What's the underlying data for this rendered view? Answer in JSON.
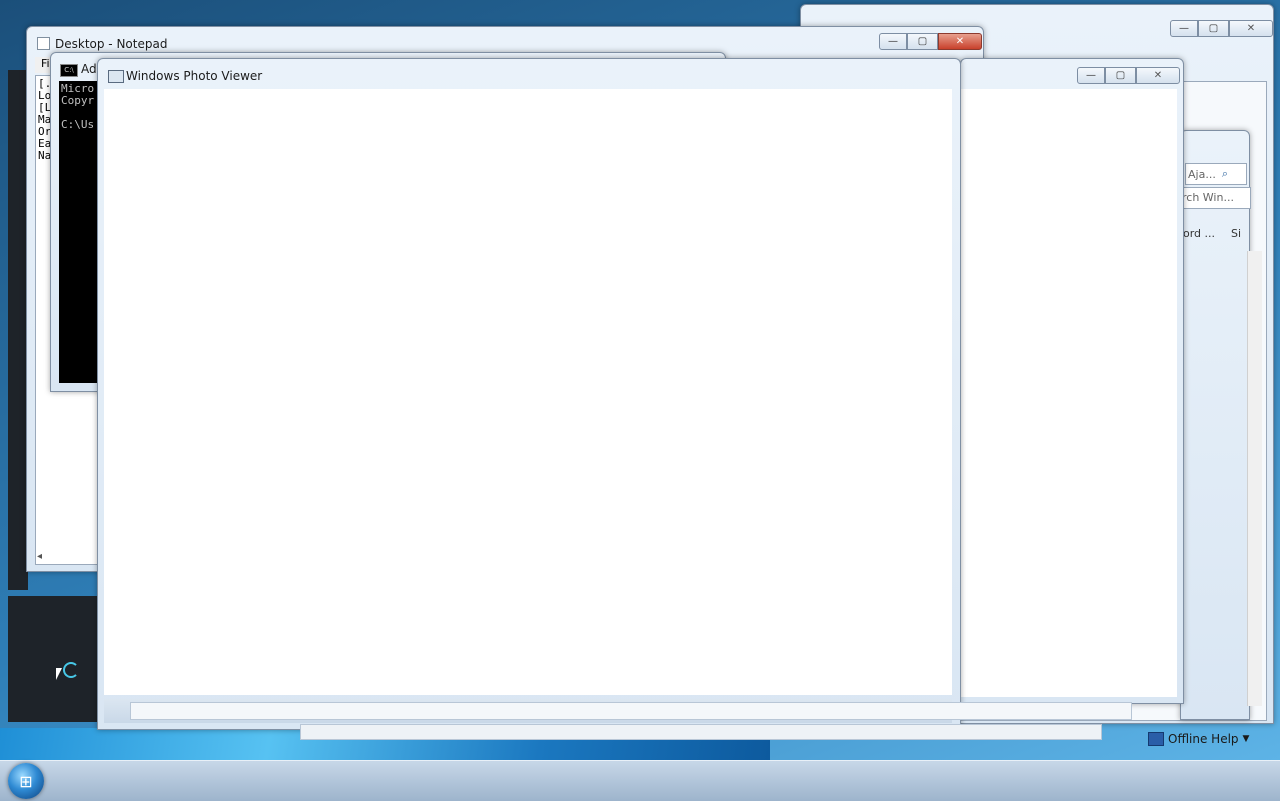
{
  "windows": {
    "notepad": {
      "title": "Desktop - Notepad",
      "menu_first": "Fi",
      "lines": [
        "[.",
        "Lo",
        "[L",
        "Ma",
        "Or",
        "Ea",
        "Na"
      ]
    },
    "cmd": {
      "title": "Ad",
      "lines": [
        "Micro",
        "Copyr",
        "",
        "C:\\Us"
      ]
    },
    "photo_viewer": {
      "title": "Windows Photo Viewer"
    },
    "explorer_right": {
      "search_1": "Aja...",
      "search_2": "rch Win...",
      "col_1": "ord ...",
      "col_2": "Si"
    }
  },
  "caption_buttons": {
    "minimize": "—",
    "maximize": "▢",
    "close": "✕"
  },
  "taskbar": {
    "offline_help": "Offline Help"
  },
  "colors": {
    "close_red": "#c8402b",
    "desktop_blue": "#2f7fb8",
    "console_black": "#000000"
  }
}
